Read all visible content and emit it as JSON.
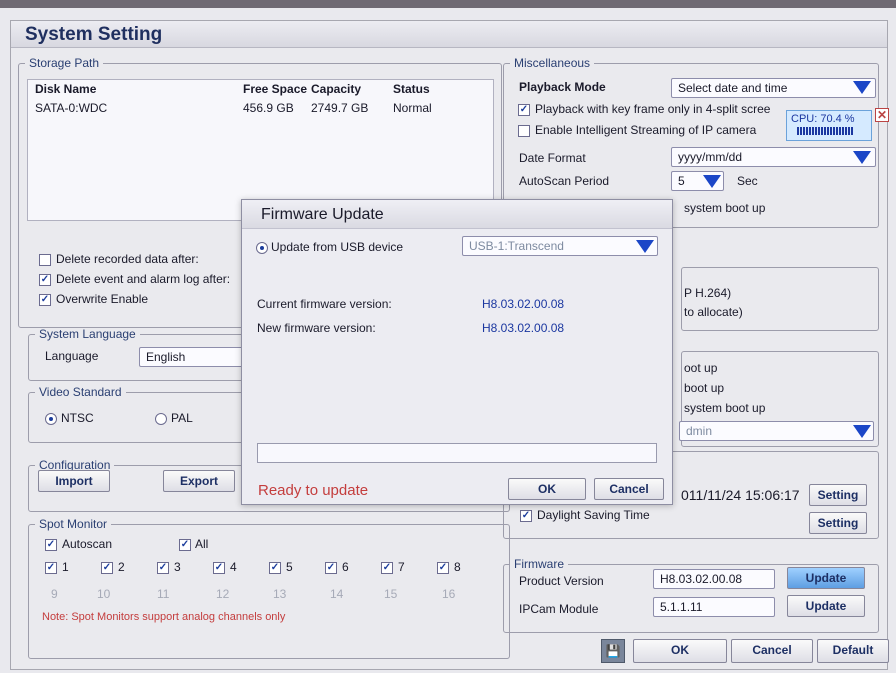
{
  "window": {
    "title": "System Setting"
  },
  "storage": {
    "legend": "Storage Path",
    "columns": [
      "Disk Name",
      "Free Space",
      "Capacity",
      "Status"
    ],
    "rows": [
      {
        "disk": "SATA-0:WDC",
        "free": "456.9 GB",
        "capacity": "2749.7 GB",
        "status": "Normal"
      }
    ],
    "options": [
      {
        "label": "Delete recorded data after:",
        "checked": false
      },
      {
        "label": "Delete event and alarm log after:",
        "checked": true
      },
      {
        "label": "Overwrite Enable",
        "checked": true
      }
    ]
  },
  "language": {
    "legend": "System Language",
    "label": "Language",
    "value": "English"
  },
  "video": {
    "legend": "Video Standard",
    "ntsc": "NTSC",
    "pal": "PAL"
  },
  "configuration": {
    "legend": "Configuration",
    "import": "Import",
    "export": "Export"
  },
  "spot": {
    "legend": "Spot Monitor",
    "autoscan": "Autoscan",
    "all": "All",
    "channels_enabled": [
      "1",
      "2",
      "3",
      "4",
      "5",
      "6",
      "7",
      "8"
    ],
    "channels_disabled": [
      "9",
      "10",
      "11",
      "12",
      "13",
      "14",
      "15",
      "16"
    ],
    "note": "Note: Spot Monitors support analog channels only"
  },
  "misc": {
    "legend": "Miscellaneous",
    "playback_mode_label": "Playback Mode",
    "playback_mode_value": "Select date and time",
    "keyframe": "Playback with key frame only in 4-split scree",
    "intelligent": "Enable Intelligent Streaming of IP camera",
    "date_format_label": "Date Format",
    "date_format_value": "yyyy/mm/dd",
    "autoscan_label": "AutoScan Period",
    "autoscan_value": "5",
    "autoscan_unit": "Sec",
    "boot_text": "system boot up",
    "cpu_text": "CPU: 70.4 %"
  },
  "partials": {
    "p1": "P H.264)",
    "p2": "to allocate)",
    "p3": "oot up",
    "p4": "boot up",
    "p5": "system boot up",
    "admin": "dmin"
  },
  "time": {
    "datetime": "011/11/24  15:06:17",
    "setting1": "Setting",
    "daylight": "Daylight Saving Time",
    "setting2": "Setting"
  },
  "firmware": {
    "legend": "Firmware",
    "product_label": "Product Version",
    "product_value": "H8.03.02.00.08",
    "ipcam_label": "IPCam Module",
    "ipcam_value": "5.1.1.11",
    "update1": "Update",
    "update2": "Update"
  },
  "footer": {
    "ok": "OK",
    "cancel": "Cancel",
    "default": "Default"
  },
  "dialog": {
    "title": "Firmware Update",
    "source_label": "Update from USB device",
    "source_value": "USB-1:Transcend",
    "current_label": "Current firmware version:",
    "current_value": "H8.03.02.00.08",
    "new_label": "New firmware version:",
    "new_value": "H8.03.02.00.08",
    "status": "Ready to update",
    "ok": "OK",
    "cancel": "Cancel"
  },
  "icons": {
    "save": "floppy-icon",
    "close": "close-icon",
    "arrow": "dropdown-triangle"
  },
  "colors": {
    "accent": "#1b46c7",
    "status_red": "#c43d3d",
    "version_blue": "#1b37a0"
  }
}
